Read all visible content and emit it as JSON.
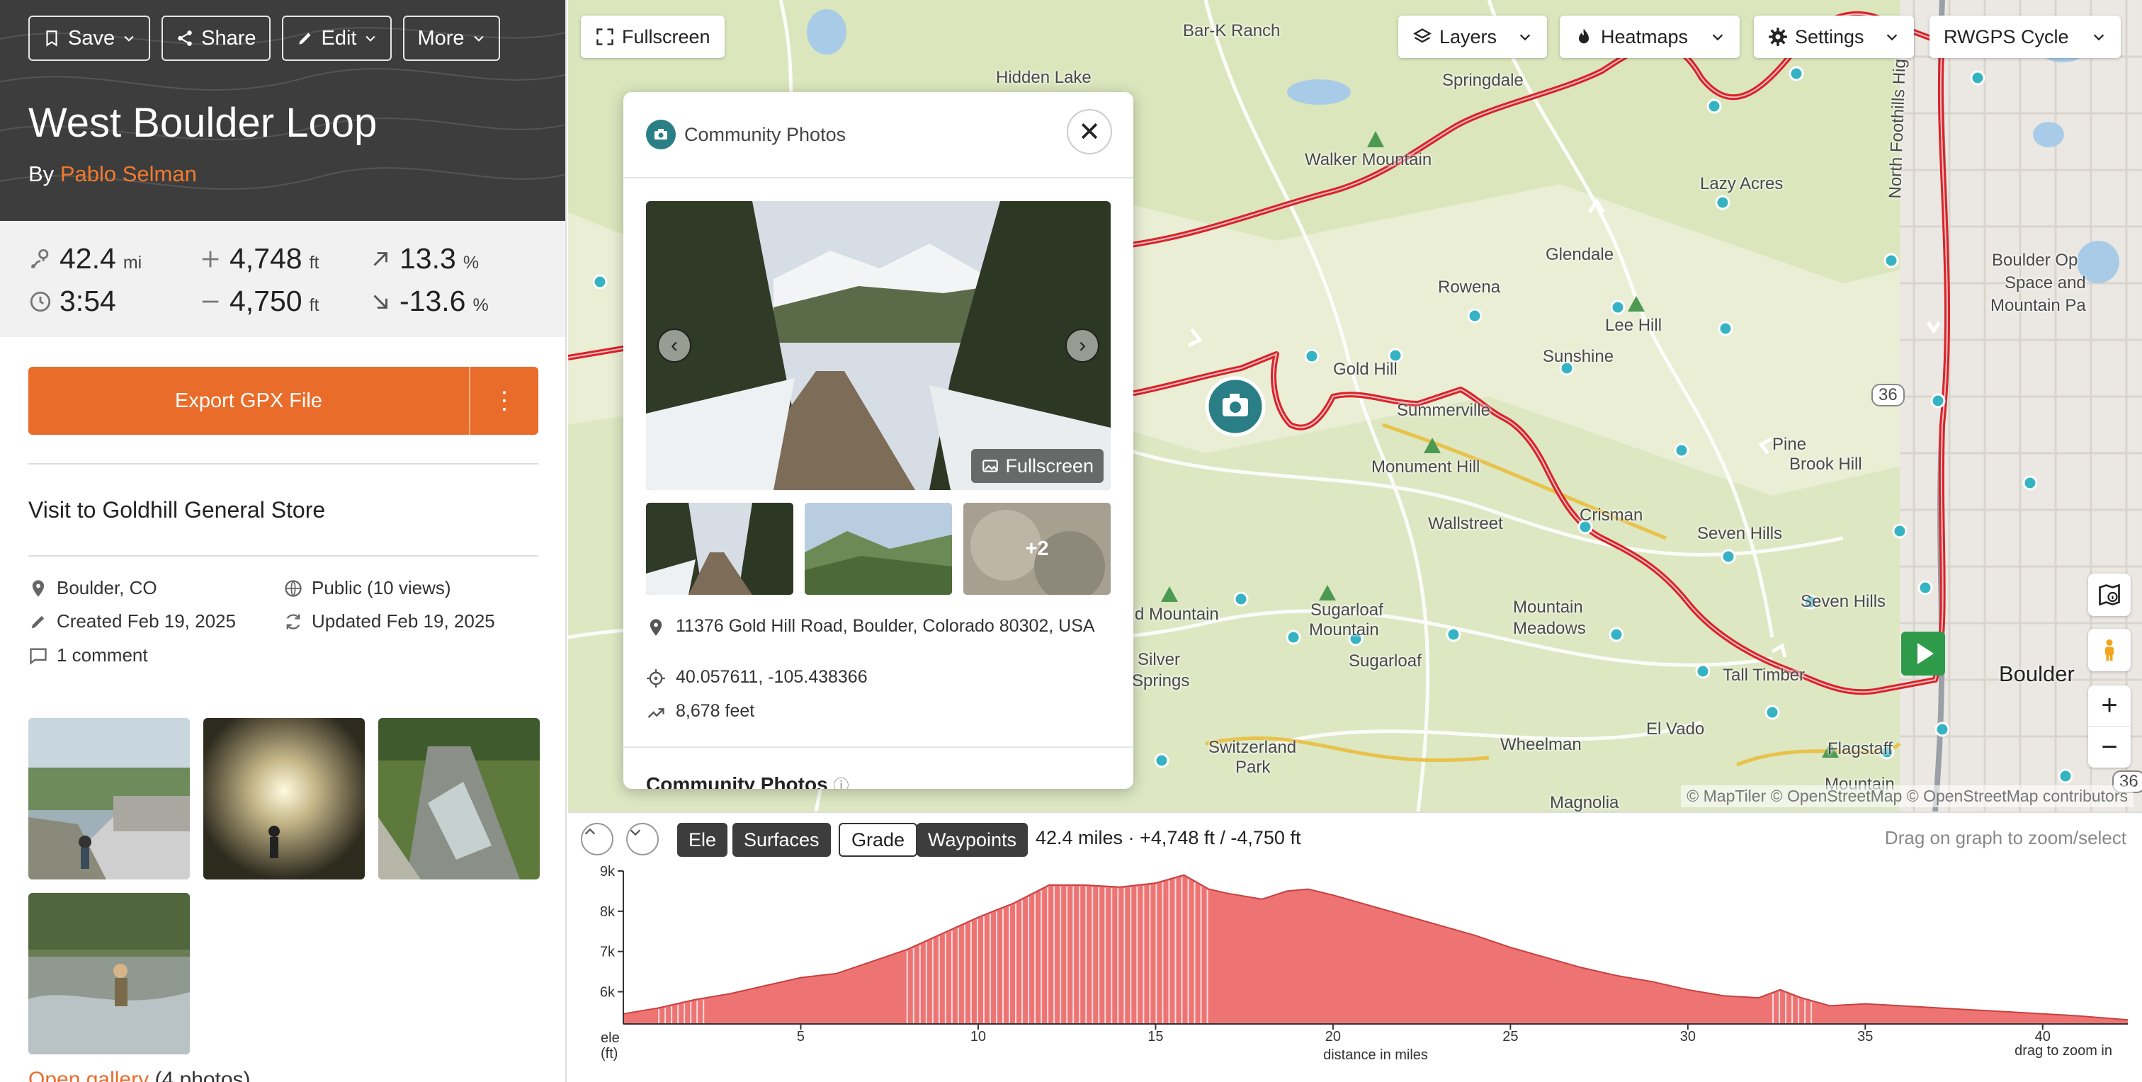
{
  "toolbar": {
    "save": "Save",
    "share": "Share",
    "edit": "Edit",
    "more": "More"
  },
  "route": {
    "title": "West Boulder Loop",
    "by_prefix": "By",
    "author": "Pablo Selman"
  },
  "stats": {
    "distance": {
      "value": "42.4",
      "unit": "mi"
    },
    "time": {
      "value": "3:54"
    },
    "ascent": {
      "value": "4,748",
      "unit": "ft"
    },
    "descent": {
      "value": "4,750",
      "unit": "ft"
    },
    "max_grade": {
      "value": "13.3",
      "unit": "%"
    },
    "min_grade": {
      "value": "-13.6",
      "unit": "%"
    }
  },
  "export": {
    "label": "Export GPX File",
    "more": "⋮"
  },
  "description": "Visit to Goldhill General Store",
  "meta": {
    "location": "Boulder, CO",
    "visibility": "Public (10 views)",
    "created": "Created Feb 19, 2025",
    "updated": "Updated Feb 19, 2025",
    "comments": "1 comment"
  },
  "gallery": {
    "link": "Open gallery",
    "count": "(4 photos)"
  },
  "map": {
    "fullscreen": "Fullscreen",
    "layers": "Layers",
    "heatmaps": "Heatmaps",
    "settings": "Settings",
    "basemap": "RWGPS Cycle",
    "attribution": "© MapTiler © OpenStreetMap © OpenStreetMap contributors",
    "zoom_in": "+",
    "zoom_out": "−",
    "highway_label": "North Foothills Highway",
    "road_badge": "36",
    "road_badge_2": "36",
    "places": {
      "bar_k_ranch": "Bar-K Ranch",
      "hidden_lake": "Hidden Lake",
      "springdale": "Springdale",
      "walker_mountain": "Walker Mountain",
      "lazy_acres": "Lazy Acres",
      "glendale": "Glendale",
      "rowena": "Rowena",
      "lee_hill": "Lee Hill",
      "sunshine": "Sunshine",
      "gold_hill": "Gold Hill",
      "summerville": "Summerville",
      "monument_hill": "Monument Hill",
      "pine_brook_hill_1": "Pine",
      "pine_brook_hill_2": "Brook Hill",
      "crisman": "Crisman",
      "wallstreet": "Wallstreet",
      "seven_hills_1": "Seven Hills",
      "seven_hills_2": "Seven Hills",
      "boulder_open_space_1": "Boulder Op",
      "boulder_open_space_2": "Space and",
      "boulder_open_space_3": "Mountain Pa",
      "d_mountain": "d Mountain",
      "sugarloaf_mountain_1": "Sugarloaf",
      "sugarloaf_mountain_2": "Mountain",
      "mountain_meadows_1": "Mountain",
      "mountain_meadows_2": "Meadows",
      "sugarloaf": "Sugarloaf",
      "silver_springs_1": "Silver",
      "silver_springs_2": "Springs",
      "tall_timber": "Tall Timber",
      "boulder": "Boulder",
      "el_vado": "El Vado",
      "wheelman": "Wheelman",
      "switzerland_park_1": "Switzerland",
      "switzerland_park_2": "Park",
      "flagstaff_mountain_1": "Flagstaff",
      "flagstaff_mountain_2": "Mountain",
      "magnolia": "Magnolia"
    }
  },
  "popup": {
    "header": "Community Photos",
    "close": "✕",
    "fullscreen": "Fullscreen",
    "more_photos": "+2",
    "address": "11376 Gold Hill Road, Boulder, Colorado 80302, USA",
    "coords": "40.057611, -105.438366",
    "elevation": "8,678 feet",
    "section_title": "Community Photos"
  },
  "elevation": {
    "tabs": [
      "Ele",
      "Surfaces",
      "Grade",
      "Waypoints"
    ],
    "summary": "42.4 miles · +4,748 ft / -4,750 ft",
    "hint": "Drag on graph to zoom/select",
    "y_axis_title_1": "ele",
    "y_axis_title_2": "(ft)",
    "x_axis_title": "distance in miles",
    "x_hint": "drag to zoom in"
  },
  "chart_data": {
    "type": "area",
    "xlabel": "distance in miles",
    "ylabel": "ele (ft)",
    "xlim": [
      0,
      42.4
    ],
    "ylim": [
      5200,
      9000
    ],
    "x_ticks": [
      5,
      10,
      15,
      20,
      25,
      30,
      35,
      40
    ],
    "x_tick_labels": [
      "5",
      "10",
      "15",
      "20",
      "25",
      "30",
      "35",
      "40"
    ],
    "y_ticks": [
      6000,
      7000,
      8000,
      9000
    ],
    "y_tick_labels": [
      "6k",
      "7k",
      "8k",
      "9k"
    ],
    "colors": {
      "fill": "#ee7474",
      "stroke": "#c94040"
    },
    "x": [
      0,
      1,
      2,
      3,
      4,
      5,
      6,
      7,
      8,
      9,
      10,
      11,
      12,
      13,
      14,
      15,
      15.8,
      16.5,
      17,
      18,
      18.7,
      19.3,
      20,
      21,
      22,
      23,
      24,
      25,
      26,
      27,
      28,
      29,
      30,
      31,
      32,
      32.6,
      33.2,
      34,
      35,
      36,
      37,
      38,
      39,
      40,
      41,
      42.4
    ],
    "y": [
      5450,
      5600,
      5800,
      5950,
      6150,
      6350,
      6450,
      6750,
      7050,
      7450,
      7850,
      8200,
      8650,
      8650,
      8600,
      8700,
      8900,
      8550,
      8450,
      8300,
      8500,
      8550,
      8400,
      8150,
      7900,
      7650,
      7400,
      7100,
      6850,
      6600,
      6400,
      6250,
      6050,
      5900,
      5850,
      6050,
      5850,
      5650,
      5700,
      5650,
      5600,
      5550,
      5500,
      5450,
      5400,
      5300
    ]
  }
}
